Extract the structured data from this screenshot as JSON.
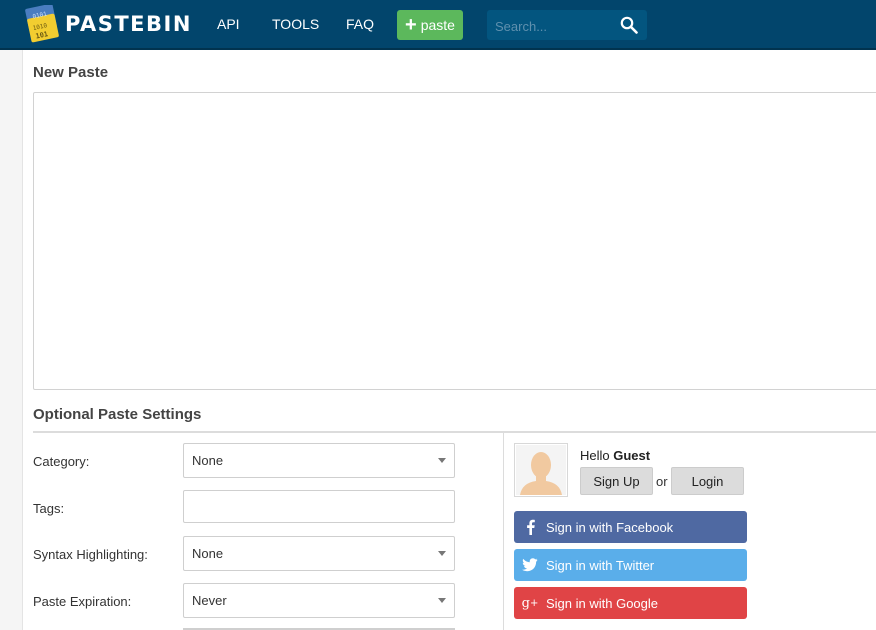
{
  "header": {
    "logo_text": "PASTEBIN",
    "logo_icon_text": [
      "0101",
      "1010",
      "101"
    ],
    "nav": [
      {
        "label": "API"
      },
      {
        "label": "TOOLS"
      },
      {
        "label": "FAQ"
      }
    ],
    "new_paste_label": "paste",
    "search_placeholder": "Search...",
    "colors": {
      "bar": "#02456c",
      "new_paste": "#5cb85c"
    }
  },
  "main": {
    "new_paste_title": "New Paste",
    "paste_content": "",
    "settings_title": "Optional Paste Settings",
    "fields": {
      "category": {
        "label": "Category:",
        "value": "None"
      },
      "tags": {
        "label": "Tags:",
        "value": ""
      },
      "syntax": {
        "label": "Syntax Highlighting:",
        "value": "None"
      },
      "expiration": {
        "label": "Paste Expiration:",
        "value": "Never"
      }
    }
  },
  "guest": {
    "hello_prefix": "Hello",
    "hello_name": "Guest",
    "sign_up_label": "Sign Up",
    "or_label": "or",
    "login_label": "Login",
    "social": [
      {
        "label": "Sign in with Facebook",
        "icon": "facebook-icon",
        "color": "#4f69a2"
      },
      {
        "label": "Sign in with Twitter",
        "icon": "twitter-icon",
        "color": "#5aaeea"
      },
      {
        "label": "Sign in with Google",
        "icon": "google-plus-icon",
        "color": "#e04446"
      }
    ]
  }
}
